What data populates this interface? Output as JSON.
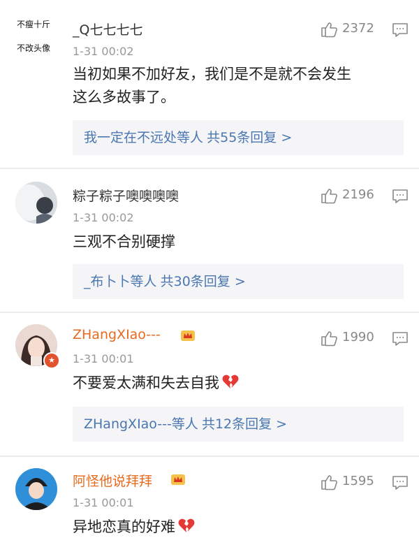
{
  "colors": {
    "vip_name": "#e86a1e",
    "link_blue": "#4a77b1",
    "meta_gray": "#999999",
    "reply_bg": "#f5f5f7"
  },
  "comments": [
    {
      "avatar_text_lines": [
        "不瘦十斤",
        "不改头像"
      ],
      "username": "_Q七七七七",
      "vip": false,
      "likes": "2372",
      "time": "1-31 00:02",
      "text_lines": [
        "当初如果不加好友，我们是不是就不会发生",
        "这么多故事了。"
      ],
      "reply": {
        "names": "我一定在不远处",
        "suffix": "等人",
        "count": "共55条回复 >"
      }
    },
    {
      "username": "粽子粽子噢噢噢噢",
      "vip": false,
      "likes": "2196",
      "time": "1-31 00:02",
      "text_lines": [
        "三观不合别硬撑"
      ],
      "reply": {
        "names": "_布卜卜",
        "suffix": "等人",
        "count": "共30条回复 >"
      }
    },
    {
      "username": "ZHangXIao---",
      "vip": true,
      "likes": "1990",
      "time": "1-31 00:01",
      "text_lines": [
        "不要爱太满和失去自我"
      ],
      "heart_icon": "broken-heart-icon",
      "reply": {
        "names": "ZHangXIao---",
        "suffix": "等人",
        "count": "共12条回复 >"
      }
    },
    {
      "username": "阿怪他说拜拜",
      "vip": true,
      "likes": "1595",
      "time": "1-31 00:01",
      "text_lines": [
        "异地恋真的好难"
      ],
      "heart_icon": "broken-heart-icon"
    }
  ]
}
